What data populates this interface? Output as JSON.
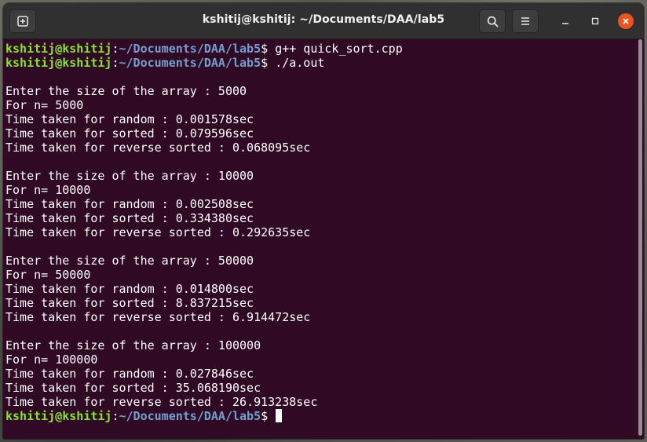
{
  "window": {
    "title": "kshitij@kshitij: ~/Documents/DAA/lab5",
    "icons": {
      "new_tab": "new-tab-icon",
      "search": "search-icon",
      "menu": "hamburger-menu-icon",
      "minimize": "minimize-icon",
      "maximize": "maximize-icon",
      "close": "close-icon"
    },
    "colors": {
      "titlebar": "#303030",
      "terminal_bg": "#300a24",
      "prompt_user": "#8ae234",
      "prompt_path": "#729fcf",
      "close_button": "#e95420"
    }
  },
  "terminal": {
    "prompt": {
      "user": "kshitij@kshitij",
      "separator": ":",
      "path": "~/Documents/DAA/lab5",
      "symbol": "$ "
    },
    "commands": [
      "g++ quick_sort.cpp",
      "./a.out"
    ],
    "output": [
      "",
      "Enter the size of the array : 5000",
      "For n= 5000",
      "Time taken for random : 0.001578sec",
      "Time taken for sorted : 0.079596sec",
      "Time taken for reverse sorted : 0.068095sec",
      "",
      "Enter the size of the array : 10000",
      "For n= 10000",
      "Time taken for random : 0.002508sec",
      "Time taken for sorted : 0.334380sec",
      "Time taken for reverse sorted : 0.292635sec",
      "",
      "Enter the size of the array : 50000",
      "For n= 50000",
      "Time taken for random : 0.014800sec",
      "Time taken for sorted : 8.837215sec",
      "Time taken for reverse sorted : 6.914472sec",
      "",
      "Enter the size of the array : 100000",
      "For n= 100000",
      "Time taken for random : 0.027846sec",
      "Time taken for sorted : 35.068190sec",
      "Time taken for reverse sorted : 26.913238sec"
    ]
  }
}
